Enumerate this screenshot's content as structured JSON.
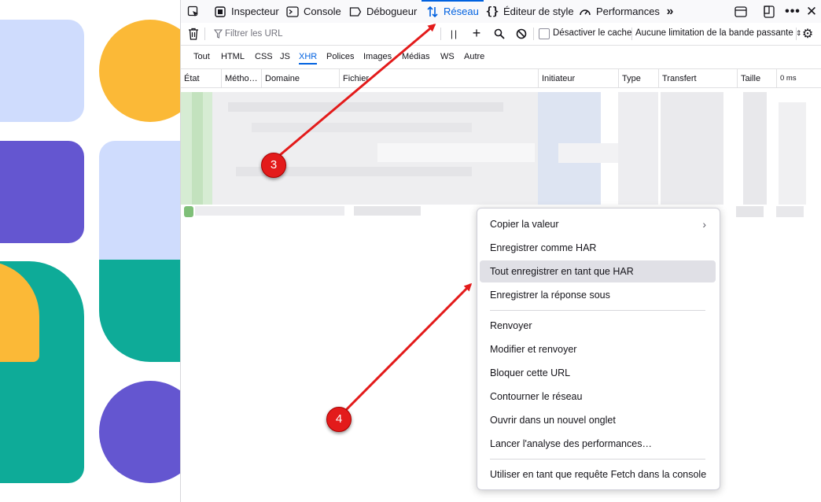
{
  "toolbar": {
    "inspector": "Inspecteur",
    "console": "Console",
    "debugger": "Débogueur",
    "network": "Réseau",
    "style_editor": "Éditeur de style",
    "performance": "Performances"
  },
  "filterbar": {
    "filter_placeholder": "Filtrer les URL",
    "disable_cache": "Désactiver le cache",
    "throttling": "Aucune limitation de la bande passante"
  },
  "types": [
    "Tout",
    "HTML",
    "CSS",
    "JS",
    "XHR",
    "Polices",
    "Images",
    "Médias",
    "WS",
    "Autre"
  ],
  "active_type": "XHR",
  "columns": [
    "État",
    "Métho…",
    "Domaine",
    "Fichier",
    "Initiateur",
    "Type",
    "Transfert",
    "Taille",
    "0 ms"
  ],
  "context_menu": {
    "items": [
      "Copier la valeur",
      "Enregistrer comme HAR",
      "Tout enregistrer en tant que HAR",
      "Enregistrer la réponse sous",
      "Renvoyer",
      "Modifier et renvoyer",
      "Bloquer cette URL",
      "Contourner le réseau",
      "Ouvrir dans un nouvel onglet",
      "Lancer l'analyse des performances…",
      "Utiliser en tant que requête Fetch dans la console"
    ],
    "highlighted": "Tout enregistrer en tant que HAR"
  },
  "annotations": {
    "step3": "3",
    "step4": "4"
  },
  "colors": {
    "accent": "#0061e0",
    "annotation_red": "#e31b1b",
    "menu_highlight": "#e0e0e6"
  },
  "icons": [
    "element-picker-icon",
    "inspector-icon",
    "console-icon",
    "debugger-icon",
    "network-icon",
    "style-editor-icon",
    "performance-icon",
    "more-tools-icon",
    "dock-icon",
    "split-window-icon",
    "overflow-menu-icon",
    "close-icon",
    "trash-icon",
    "filter-icon",
    "pause-icon",
    "plus-icon",
    "search-icon",
    "block-icon",
    "settings-gear-icon",
    "chevron-right-icon"
  ]
}
